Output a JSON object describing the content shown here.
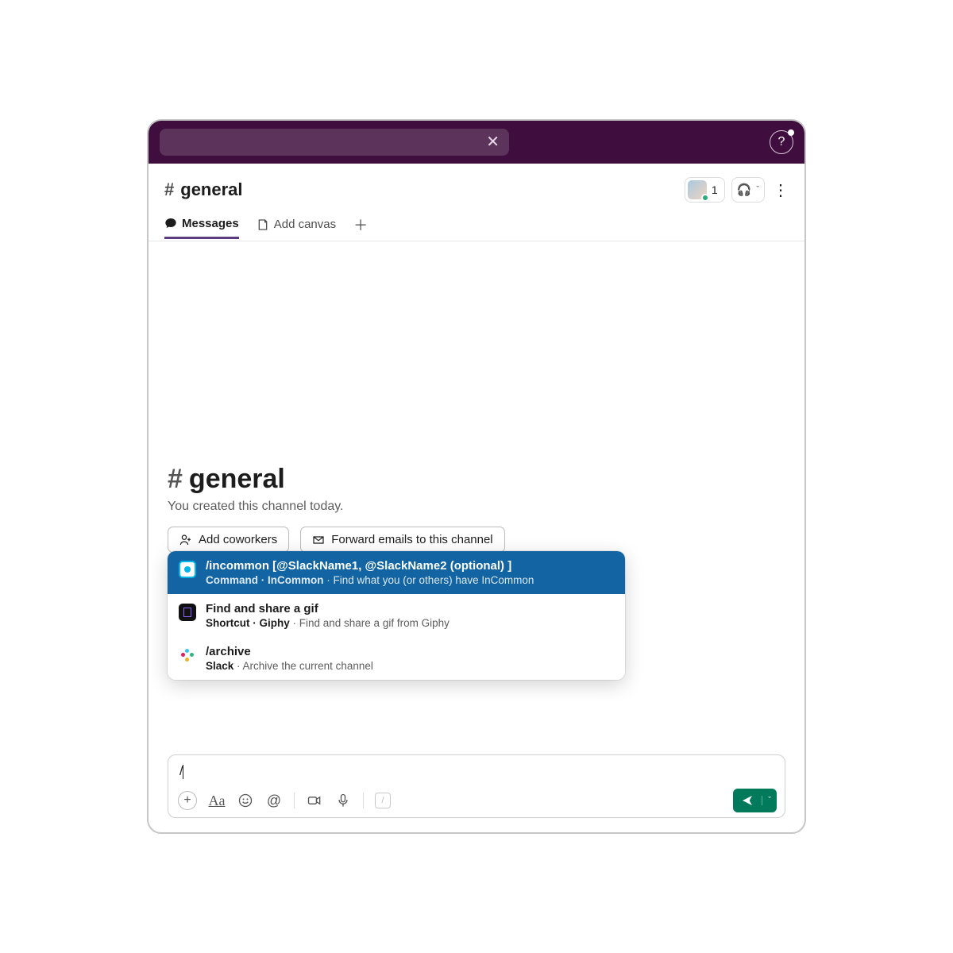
{
  "colors": {
    "topbar": "#3f0e3f",
    "accent": "#5e3a7e",
    "selection": "#1264a3",
    "send": "#007a5a"
  },
  "header": {
    "channel_name": "general",
    "member_count": "1"
  },
  "tabs": {
    "messages": "Messages",
    "add_canvas": "Add canvas"
  },
  "intro": {
    "channel_name": "general",
    "subtitle": "You created this channel today.",
    "add_coworkers": "Add coworkers",
    "forward_emails": "Forward emails to this channel"
  },
  "command_menu": [
    {
      "title": "/incommon [@SlackName1, @SlackName2 (optional) ]",
      "source_label": "Command · InCommon",
      "desc_sep": " · ",
      "description": "Find what you (or others) have InCommon",
      "selected": true,
      "icon": "incommon"
    },
    {
      "title": "Find and share a gif",
      "source_label": "Shortcut · Giphy",
      "desc_sep": " · ",
      "description": "Find and share a gif from Giphy",
      "selected": false,
      "icon": "giphy"
    },
    {
      "title": "/archive",
      "source_label": "Slack",
      "desc_sep": " · ",
      "description": "Archive the current channel",
      "selected": false,
      "icon": "slack"
    }
  ],
  "composer": {
    "value": "/"
  }
}
